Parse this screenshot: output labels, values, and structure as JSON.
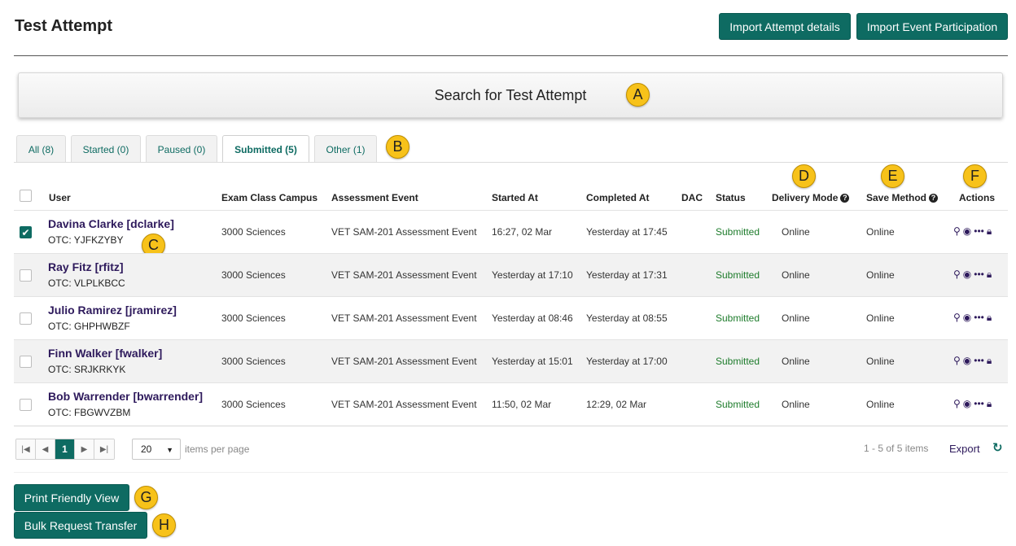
{
  "page": {
    "title": "Test Attempt"
  },
  "header": {
    "import_attempt_label": "Import Attempt details",
    "import_event_label": "Import Event Participation"
  },
  "search": {
    "label": "Search for Test Attempt"
  },
  "tabs": [
    {
      "label": "All (8)"
    },
    {
      "label": "Started (0)"
    },
    {
      "label": "Paused (0)"
    },
    {
      "label": "Submitted (5)",
      "active": true
    },
    {
      "label": "Other (1)"
    }
  ],
  "markers": {
    "a": "A",
    "b": "B",
    "c": "C",
    "d": "D",
    "e": "E",
    "f": "F",
    "g": "G",
    "h": "H"
  },
  "table": {
    "columns": {
      "user": "User",
      "campus": "Exam Class Campus",
      "event": "Assessment Event",
      "started": "Started At",
      "completed": "Completed At",
      "dac": "DAC",
      "status": "Status",
      "delivery": "Delivery Mode",
      "save": "Save Method",
      "actions": "Actions"
    },
    "rows": [
      {
        "name": "Davina Clarke [dclarke]",
        "otc": "OTC: YJFKZYBY",
        "campus": "3000 Sciences",
        "event": "VET SAM-201 Assessment Event",
        "started": "16:27, 02 Mar",
        "completed": "Yesterday at 17:45",
        "dac": "",
        "status": "Submitted",
        "delivery": "Online",
        "save": "Online",
        "checked": true
      },
      {
        "name": "Ray Fitz [rfitz]",
        "otc": "OTC: VLPLKBCC",
        "campus": "3000 Sciences",
        "event": "VET SAM-201 Assessment Event",
        "started": "Yesterday at 17:10",
        "completed": "Yesterday at 17:31",
        "dac": "",
        "status": "Submitted",
        "delivery": "Online",
        "save": "Online",
        "checked": false
      },
      {
        "name": "Julio Ramirez [jramirez]",
        "otc": "OTC: GHPHWBZF",
        "campus": "3000 Sciences",
        "event": "VET SAM-201 Assessment Event",
        "started": "Yesterday at 08:46",
        "completed": "Yesterday at 08:55",
        "dac": "",
        "status": "Submitted",
        "delivery": "Online",
        "save": "Online",
        "checked": false
      },
      {
        "name": "Finn Walker [fwalker]",
        "otc": "OTC: SRJKRKYK",
        "campus": "3000 Sciences",
        "event": "VET SAM-201 Assessment Event",
        "started": "Yesterday at 15:01",
        "completed": "Yesterday at 17:00",
        "dac": "",
        "status": "Submitted",
        "delivery": "Online",
        "save": "Online",
        "checked": false
      },
      {
        "name": "Bob Warrender [bwarrender]",
        "otc": "OTC: FBGWVZBM",
        "campus": "3000 Sciences",
        "event": "VET SAM-201 Assessment Event",
        "started": "11:50, 02 Mar",
        "completed": "12:29, 02 Mar",
        "dac": "",
        "status": "Submitted",
        "delivery": "Online",
        "save": "Online",
        "checked": false
      }
    ]
  },
  "pager": {
    "first": "|◀",
    "prev": "◀",
    "current_page": "1",
    "next": "▶",
    "last": "▶|",
    "page_size": "20",
    "items_per_page_label": "items per page",
    "range_text": "1 - 5 of 5 items",
    "export_label": "Export",
    "refresh_icon": "↻"
  },
  "footer": {
    "print_label": "Print Friendly View",
    "bulk_label": "Bulk Request Transfer"
  },
  "colors": {
    "accent": "#0e6b62",
    "link": "#2e1a5c",
    "status_submitted": "#1e7c2c",
    "marker": "#f7c21a"
  }
}
